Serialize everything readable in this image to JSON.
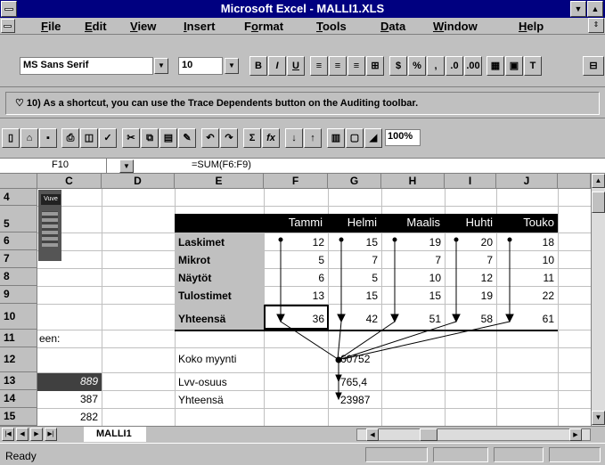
{
  "window": {
    "title": "Microsoft Excel - MALLI1.XLS"
  },
  "menu": {
    "items": [
      {
        "label": "File",
        "ul": "F"
      },
      {
        "label": "Edit",
        "ul": "E"
      },
      {
        "label": "View",
        "ul": "V"
      },
      {
        "label": "Insert",
        "ul": "I"
      },
      {
        "label": "Format",
        "ul": "o"
      },
      {
        "label": "Tools",
        "ul": "T"
      },
      {
        "label": "Data",
        "ul": "D"
      },
      {
        "label": "Window",
        "ul": "W"
      },
      {
        "label": "Help",
        "ul": "H"
      }
    ]
  },
  "formatting": {
    "font_name": "MS Sans Serif",
    "font_size": "10",
    "bold": "B",
    "italic": "I",
    "underline": "U",
    "percent": "%",
    "comma": ","
  },
  "tip": {
    "text": "10) As a shortcut, you can use the Trace Dependents button on the Auditing toolbar."
  },
  "standard": {
    "zoom": "100%",
    "sum": "Σ",
    "fx": "fx"
  },
  "formula_bar": {
    "cell_ref": "F10",
    "formula": "=SUM(F6:F9)"
  },
  "columns": [
    "C",
    "D",
    "E",
    "F",
    "G",
    "H",
    "I",
    "J"
  ],
  "rows": [
    "4",
    "5",
    "6",
    "7",
    "8",
    "9",
    "10",
    "11",
    "12",
    "13",
    "14",
    "15"
  ],
  "table": {
    "months": [
      "Tammi",
      "Helmi",
      "Maalis",
      "Huhti",
      "Touko"
    ],
    "rows": [
      {
        "label": "Laskimet",
        "values": [
          "12",
          "15",
          "19",
          "20",
          "18"
        ]
      },
      {
        "label": "Mikrot",
        "values": [
          "5",
          "7",
          "7",
          "7",
          "10"
        ]
      },
      {
        "label": "Näytöt",
        "values": [
          "6",
          "5",
          "10",
          "12",
          "11"
        ]
      },
      {
        "label": "Tulostimet",
        "values": [
          "13",
          "15",
          "15",
          "19",
          "22"
        ]
      },
      {
        "label": "Yhteensä",
        "values": [
          "36",
          "42",
          "51",
          "58",
          "61"
        ]
      }
    ]
  },
  "summary": [
    {
      "label": "Koko myynti",
      "value": "60752"
    },
    {
      "label": "Lvv-osuus",
      "value": "765,4"
    },
    {
      "label": "Yhteensä",
      "value": "23987"
    }
  ],
  "column_c": {
    "r11": "een:",
    "r13": "889",
    "r14": "387",
    "r15": "282",
    "picture_label": "Vuve"
  },
  "sheet": {
    "active_tab": "MALLI1"
  },
  "status": {
    "text": "Ready"
  }
}
